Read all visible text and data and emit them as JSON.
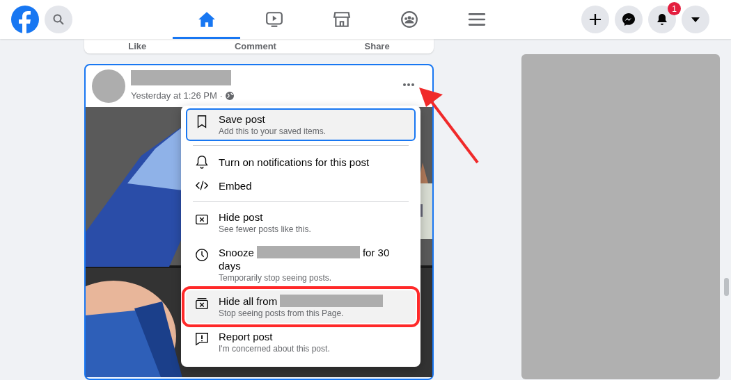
{
  "navbar": {
    "tabs": [
      {
        "kind": "home",
        "selected": true
      },
      {
        "kind": "watch",
        "selected": false
      },
      {
        "kind": "marketplace",
        "selected": false
      },
      {
        "kind": "groups",
        "selected": false
      },
      {
        "kind": "menu",
        "selected": false
      }
    ],
    "actions": [
      {
        "kind": "create"
      },
      {
        "kind": "messenger"
      },
      {
        "kind": "notifications",
        "badge": "1"
      },
      {
        "kind": "account"
      }
    ]
  },
  "previous_post": {
    "actions": [
      "Like",
      "Comment",
      "Share"
    ]
  },
  "post": {
    "timestamp": "Yesterday at 1:26 PM ·",
    "menu": {
      "sections": [
        [
          {
            "kind": "save",
            "title": "Save post",
            "subtitle": "Add this to your saved items.",
            "focused": true,
            "highlighted": false
          }
        ],
        [
          {
            "kind": "notify",
            "title": "Turn on notifications for this post",
            "focused": false,
            "highlighted": false
          },
          {
            "kind": "embed",
            "title": "Embed",
            "focused": false,
            "highlighted": false
          }
        ],
        [
          {
            "kind": "hide",
            "title": "Hide post",
            "subtitle": "See fewer posts like this.",
            "focused": false,
            "highlighted": false
          },
          {
            "kind": "snooze",
            "title": "Snooze",
            "redacted": true,
            "title_suffix": "for 30 days",
            "subtitle": "Temporarily stop seeing posts.",
            "focused": false,
            "highlighted": false
          },
          {
            "kind": "hide_all",
            "title": "Hide all from",
            "redacted": true,
            "subtitle": "Stop seeing posts from this Page.",
            "focused": false,
            "highlighted": true
          },
          {
            "kind": "report",
            "title": "Report post",
            "subtitle": "I'm concerned about this post.",
            "focused": false,
            "highlighted": false
          }
        ]
      ]
    }
  }
}
